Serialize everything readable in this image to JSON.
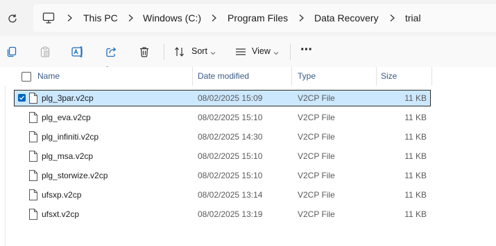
{
  "address_bar": {
    "breadcrumbs": [
      "This PC",
      "Windows (C:)",
      "Program Files",
      "Data Recovery",
      "trial"
    ]
  },
  "toolbar": {
    "sort_label": "Sort",
    "view_label": "View",
    "more_label": "···"
  },
  "columns": {
    "name": "Name",
    "date": "Date modified",
    "type": "Type",
    "size": "Size"
  },
  "files": [
    {
      "name": "plg_3par.v2cp",
      "date": "08/02/2025 15:09",
      "type": "V2CP File",
      "size": "11 KB",
      "selected": true
    },
    {
      "name": "plg_eva.v2cp",
      "date": "08/02/2025 15:10",
      "type": "V2CP File",
      "size": "11 KB"
    },
    {
      "name": "plg_infiniti.v2cp",
      "date": "08/02/2025 14:30",
      "type": "V2CP File",
      "size": "11 KB"
    },
    {
      "name": "plg_msa.v2cp",
      "date": "08/02/2025 15:10",
      "type": "V2CP File",
      "size": "11 KB"
    },
    {
      "name": "plg_storwize.v2cp",
      "date": "08/02/2025 15:10",
      "type": "V2CP File",
      "size": "11 KB"
    },
    {
      "name": "ufsxp.v2cp",
      "date": "08/02/2025 13:14",
      "type": "V2CP File",
      "size": "11 KB"
    },
    {
      "name": "ufsxt.v2cp",
      "date": "08/02/2025 13:19",
      "type": "V2CP File",
      "size": "11 KB"
    }
  ],
  "colors": {
    "selection": "#cce8ff",
    "accent": "#0067c0",
    "header_text": "#3a5a86"
  },
  "icons": [
    "refresh-icon",
    "computer-icon",
    "chevron-right-icon",
    "copy-icon",
    "paste-icon",
    "rename-icon",
    "share-icon",
    "delete-icon",
    "sort-icon",
    "view-icon",
    "file-icon"
  ]
}
